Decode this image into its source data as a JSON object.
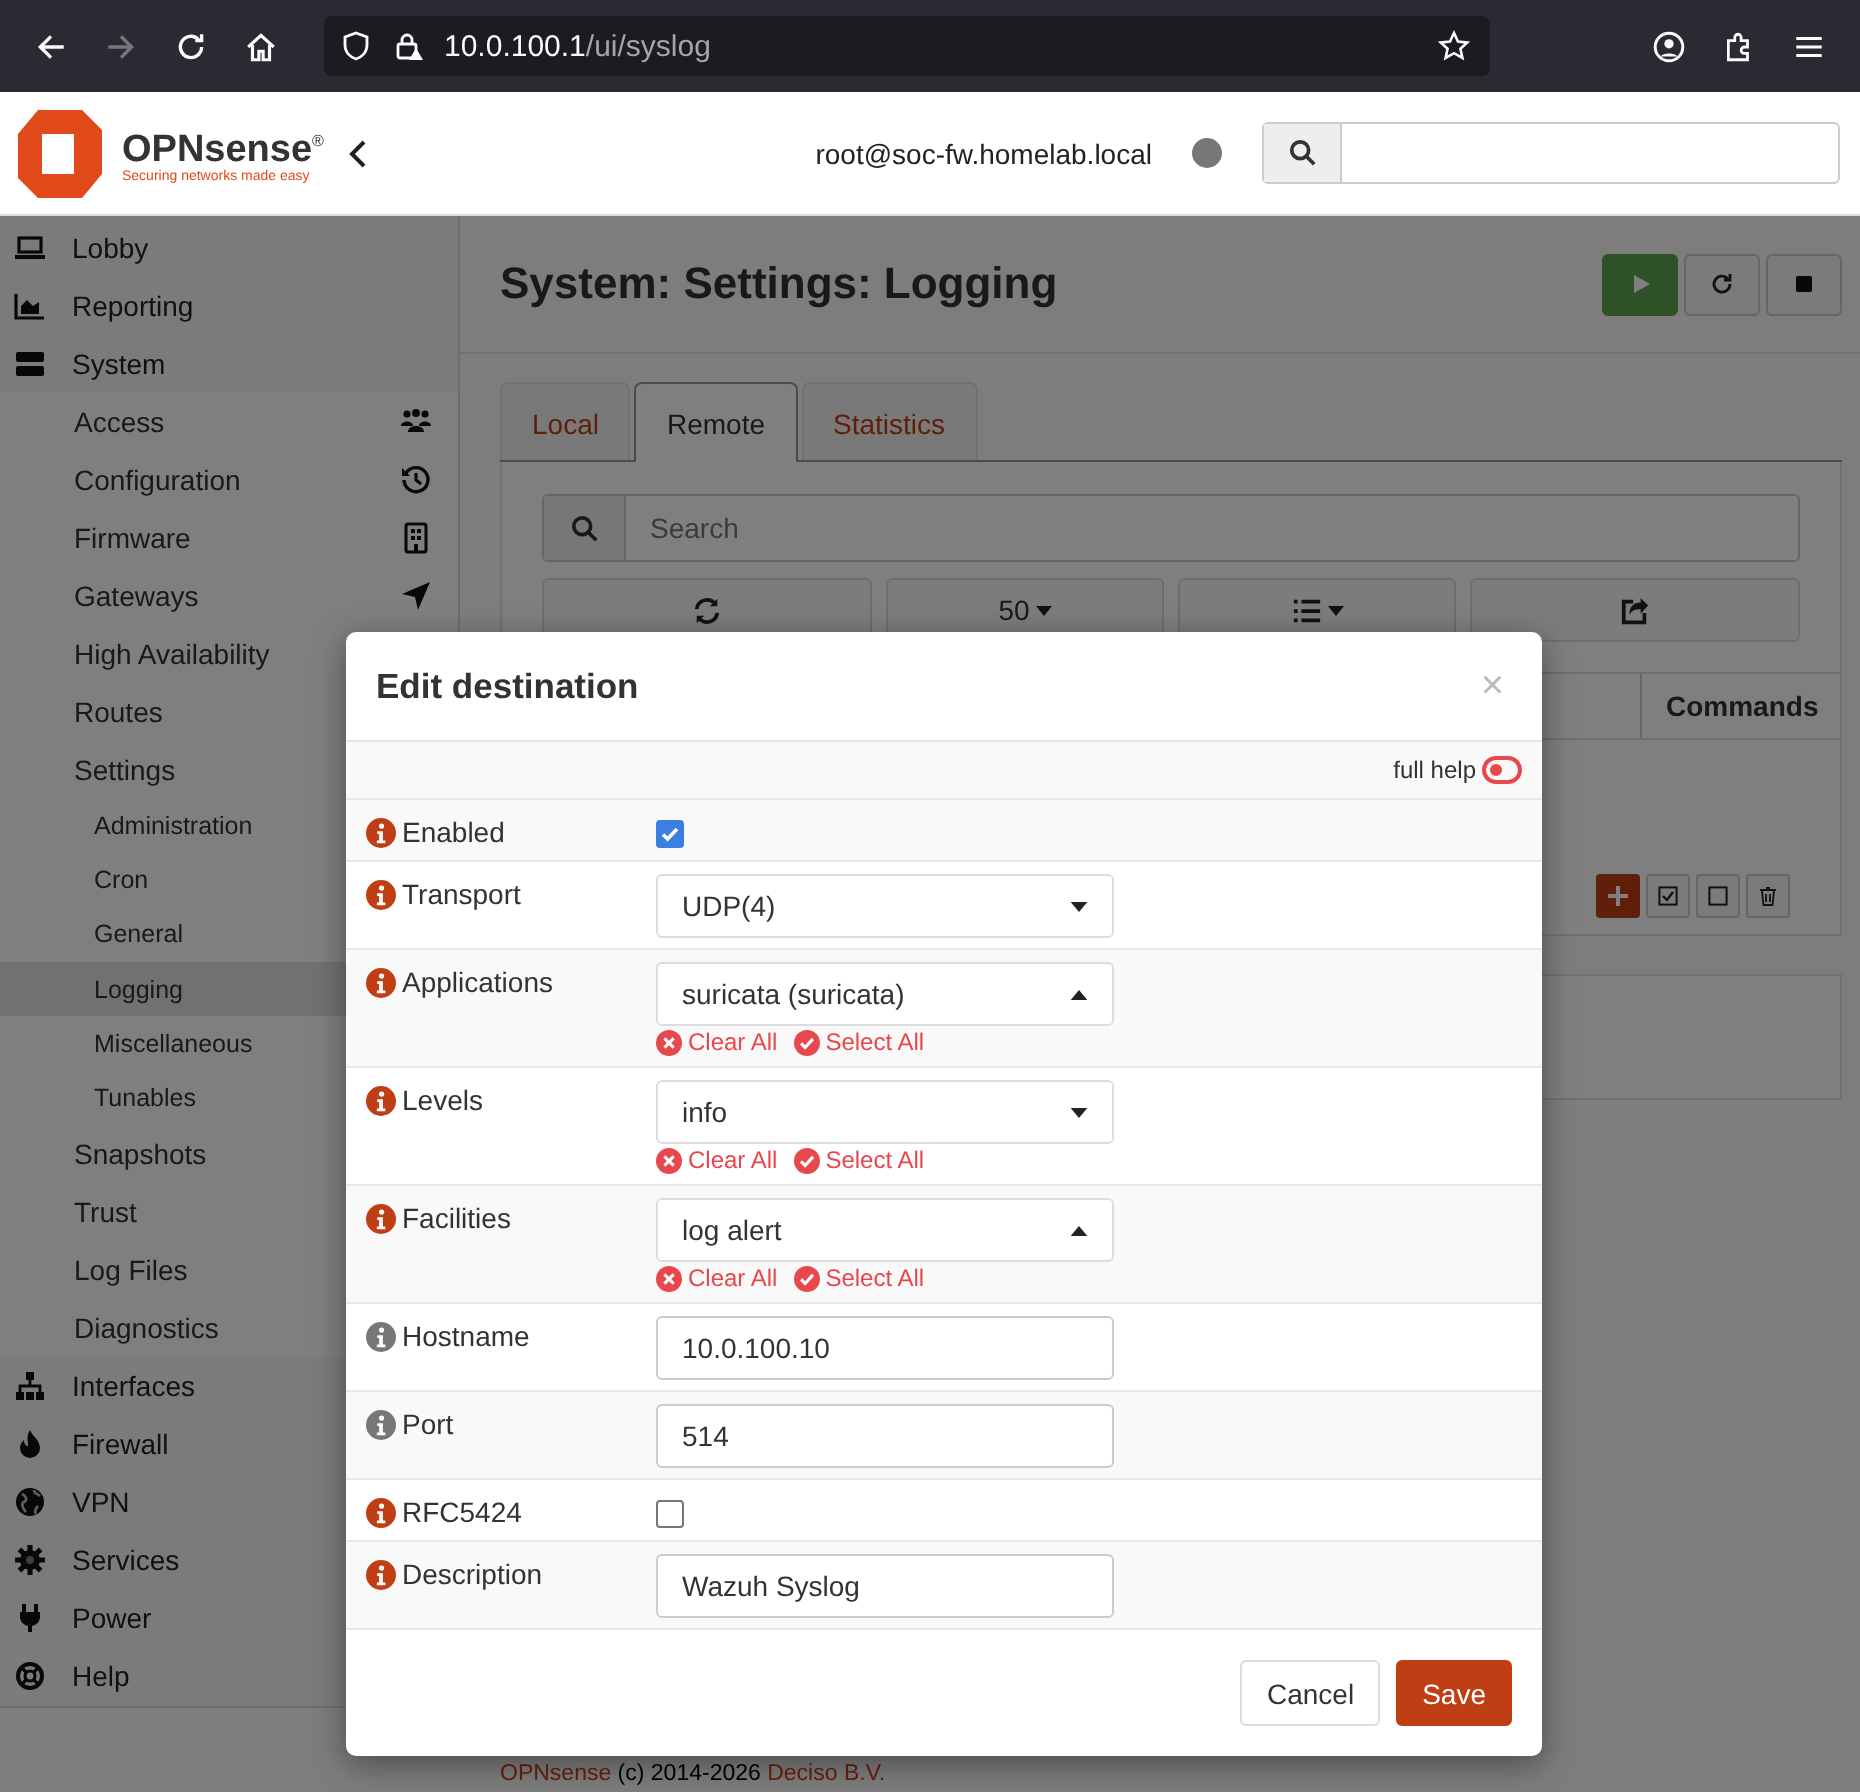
{
  "browser": {
    "url_host": "10.0.100.1",
    "url_path": "/ui/syslog",
    "forward_disabled": true
  },
  "header": {
    "brand": "OPNsense",
    "brand_mark": "®",
    "tagline": "Securing networks made easy",
    "user": "root@soc-fw.homelab.local"
  },
  "sidebar": {
    "items": [
      {
        "label": "Lobby",
        "selected": false
      },
      {
        "label": "Reporting",
        "selected": false
      },
      {
        "label": "System",
        "selected": false,
        "children": [
          {
            "label": "Access",
            "selected": false
          },
          {
            "label": "Configuration",
            "selected": false
          },
          {
            "label": "Firmware",
            "selected": false
          },
          {
            "label": "Gateways",
            "selected": false
          },
          {
            "label": "High Availability",
            "selected": false
          },
          {
            "label": "Routes",
            "selected": false
          },
          {
            "label": "Settings",
            "selected": false,
            "children": [
              {
                "label": "Administration",
                "selected": false
              },
              {
                "label": "Cron",
                "selected": false
              },
              {
                "label": "General",
                "selected": false
              },
              {
                "label": "Logging",
                "selected": true
              },
              {
                "label": "Miscellaneous",
                "selected": false
              },
              {
                "label": "Tunables",
                "selected": false
              }
            ]
          },
          {
            "label": "Snapshots",
            "selected": false
          },
          {
            "label": "Trust",
            "selected": false
          },
          {
            "label": "Log Files",
            "selected": false
          },
          {
            "label": "Diagnostics",
            "selected": false
          }
        ]
      },
      {
        "label": "Interfaces",
        "selected": false
      },
      {
        "label": "Firewall",
        "selected": false
      },
      {
        "label": "VPN",
        "selected": false
      },
      {
        "label": "Services",
        "selected": false
      },
      {
        "label": "Power",
        "selected": false
      },
      {
        "label": "Help",
        "selected": false
      }
    ]
  },
  "page": {
    "title": "System: Settings: Logging",
    "tabs": [
      {
        "label": "Local",
        "selected": false
      },
      {
        "label": "Remote",
        "selected": true
      },
      {
        "label": "Statistics",
        "selected": false
      }
    ],
    "search": {
      "placeholder": "Search"
    },
    "page_size": "50",
    "columns": [
      "Commands"
    ],
    "footer": [
      {
        "text": "OPNsense",
        "link": true
      },
      {
        "text": " (c) 2014-2026 ",
        "link": false
      },
      {
        "text": "Deciso B.V.",
        "link": true
      }
    ]
  },
  "modal": {
    "title": "Edit destination",
    "close": "×",
    "full_help": {
      "label": "full help",
      "on": false
    },
    "rows": [
      {
        "label": "Enabled",
        "help": true,
        "kind": "checkbox",
        "checked": true
      },
      {
        "label": "Transport",
        "help": true,
        "kind": "select",
        "value": "UDP(4)",
        "expanded": false
      },
      {
        "label": "Applications",
        "help": true,
        "kind": "multiselect",
        "value": "suricata (suricata)",
        "expanded": true,
        "clear": "Clear All",
        "select": "Select All"
      },
      {
        "label": "Levels",
        "help": true,
        "kind": "multiselect",
        "value": "info",
        "expanded": false,
        "clear": "Clear All",
        "select": "Select All"
      },
      {
        "label": "Facilities",
        "help": true,
        "kind": "multiselect",
        "value": "log alert",
        "expanded": true,
        "clear": "Clear All",
        "select": "Select All"
      },
      {
        "label": "Hostname",
        "help": false,
        "kind": "text",
        "value": "10.0.100.10"
      },
      {
        "label": "Port",
        "help": false,
        "kind": "text",
        "value": "514"
      },
      {
        "label": "RFC5424",
        "help": true,
        "kind": "checkbox",
        "checked": false
      },
      {
        "label": "Description",
        "help": true,
        "kind": "text",
        "value": "Wazuh Syslog"
      }
    ],
    "buttons": [
      {
        "label": "Cancel",
        "primary": false
      },
      {
        "label": "Save",
        "primary": true
      }
    ]
  }
}
